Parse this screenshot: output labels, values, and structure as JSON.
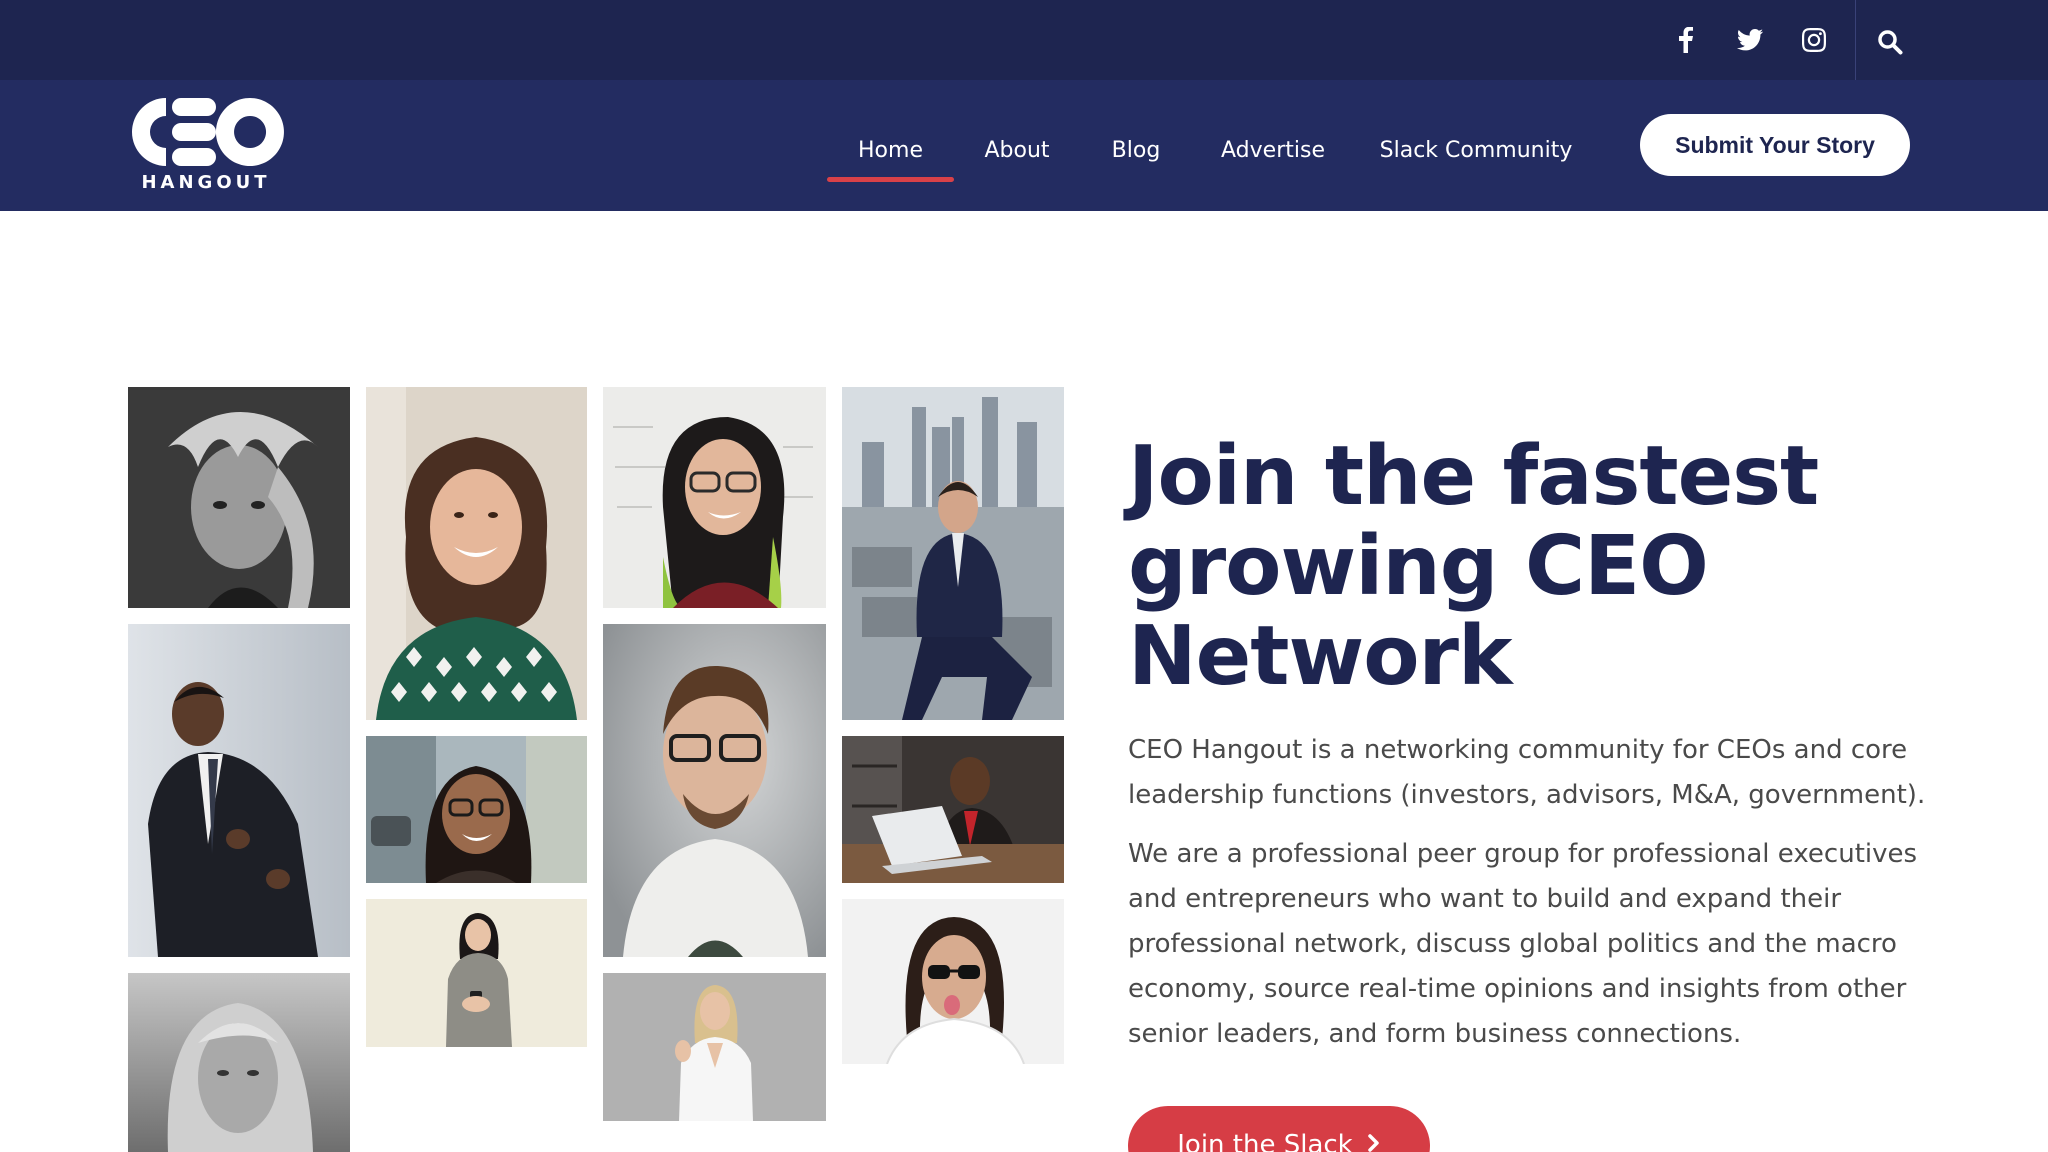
{
  "brand": {
    "logo_text": "CEO",
    "logo_subtitle": "HANGOUT",
    "colors": {
      "navy_dark": "#1e2550",
      "navy": "#232c61",
      "accent_red": "#d94148",
      "white": "#ffffff"
    }
  },
  "topbar": {
    "social_icons": [
      "facebook-icon",
      "twitter-icon",
      "instagram-icon"
    ],
    "search_icon": "search-icon"
  },
  "nav": {
    "items": [
      {
        "label": "Home",
        "active": true
      },
      {
        "label": "About",
        "active": false
      },
      {
        "label": "Blog",
        "active": false
      },
      {
        "label": "Advertise",
        "active": false
      },
      {
        "label": "Slack Community",
        "active": false
      }
    ],
    "submit_label": "Submit Your Story"
  },
  "hero": {
    "headline_line1": "Join the fastest",
    "headline_line2": "growing CEO",
    "headline_line3": "Network",
    "paragraph1": "CEO Hangout is a networking community for CEOs and core leadership functions (investors, advisors, M&A, government).",
    "paragraph2": "We are a professional peer group for professional executives and entrepreneurs who want to build and expand their professional network, discuss global politics and the macro economy, source real-time opinions and insights from other senior leaders, and form business connections.",
    "cta_label": "Join the Slack",
    "cta_icon": "chevron-right-icon"
  },
  "gallery": {
    "photos": [
      "bw-man-long-hair-photo",
      "woman-curly-hair-smiling-photo",
      "woman-glasses-whiteboard-photo",
      "man-suit-rooftop-photo",
      "man-suit-looking-down-photo",
      "woman-glasses-street-photo",
      "man-glasses-grey-backdrop-photo",
      "man-laptop-photo",
      "woman-holding-phone-photo",
      "man-sunglasses-tongue-photo",
      "bw-woman-blonde-photo",
      "woman-blonde-waving-photo"
    ]
  }
}
